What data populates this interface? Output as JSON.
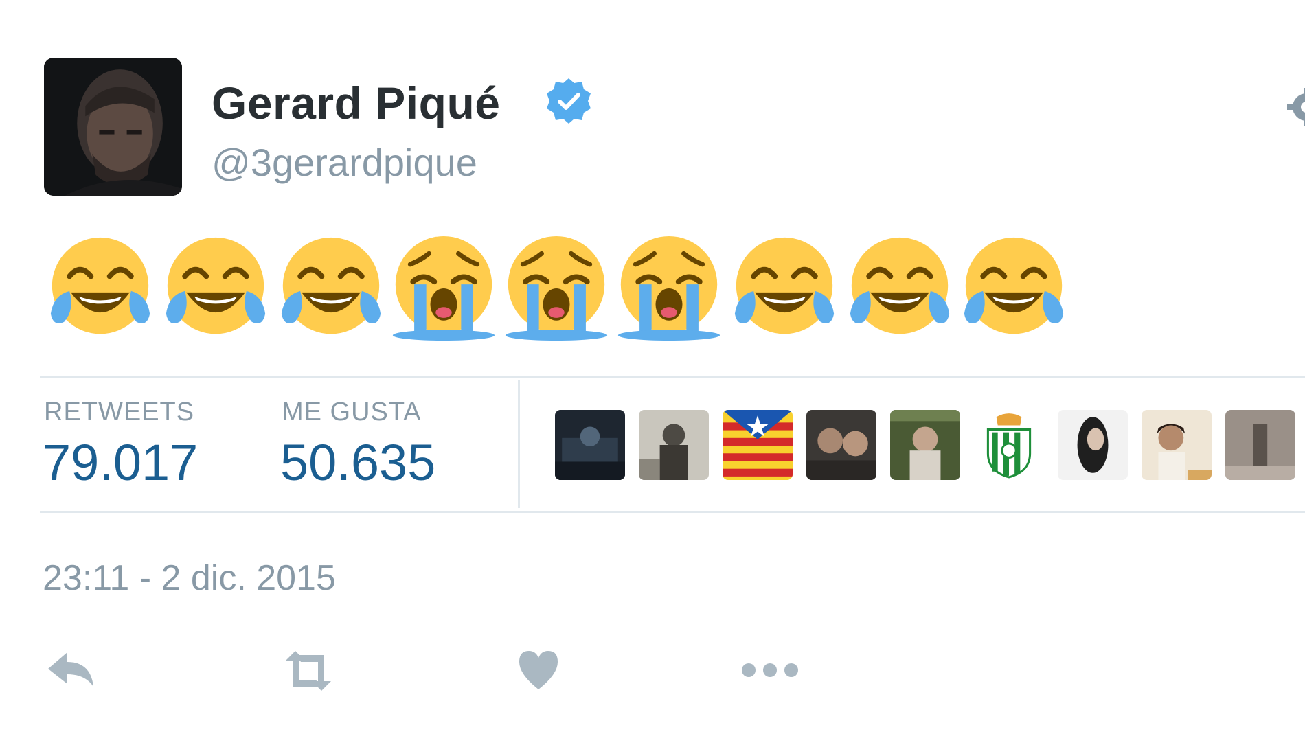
{
  "tweet": {
    "author": {
      "display_name": "Gerard Piqué",
      "handle": "@3gerardpique",
      "verified": true,
      "avatar": "avatar-photo"
    },
    "text_emojis": [
      "face-with-tears-of-joy",
      "face-with-tears-of-joy",
      "face-with-tears-of-joy",
      "loudly-crying-face",
      "loudly-crying-face",
      "loudly-crying-face",
      "face-with-tears-of-joy",
      "face-with-tears-of-joy",
      "face-with-tears-of-joy"
    ],
    "stats": {
      "retweets_label": "RETWEETS",
      "retweets_value": "79.017",
      "likes_label": "ME GUSTA",
      "likes_value": "50.635"
    },
    "liked_by_avatars": [
      "liker-avatar-1",
      "liker-avatar-2",
      "liker-avatar-senyera-flag",
      "liker-avatar-4",
      "liker-avatar-5",
      "liker-avatar-betis-crest",
      "liker-avatar-7",
      "liker-avatar-8",
      "liker-avatar-9"
    ],
    "timestamp": "23:11 - 2 dic. 2015",
    "actions": [
      "reply-icon",
      "retweet-icon",
      "like-icon",
      "more-icon"
    ],
    "header_icons": [
      "verified-badge-icon",
      "gear-icon"
    ]
  },
  "colors": {
    "name": "#292f33",
    "muted": "#8899a6",
    "stat_value": "#1b5e91",
    "divider": "#e1e8ed",
    "verified_blue": "#55acee",
    "emoji_yellow": "#ffcc4d",
    "tear_blue": "#5dadec"
  }
}
